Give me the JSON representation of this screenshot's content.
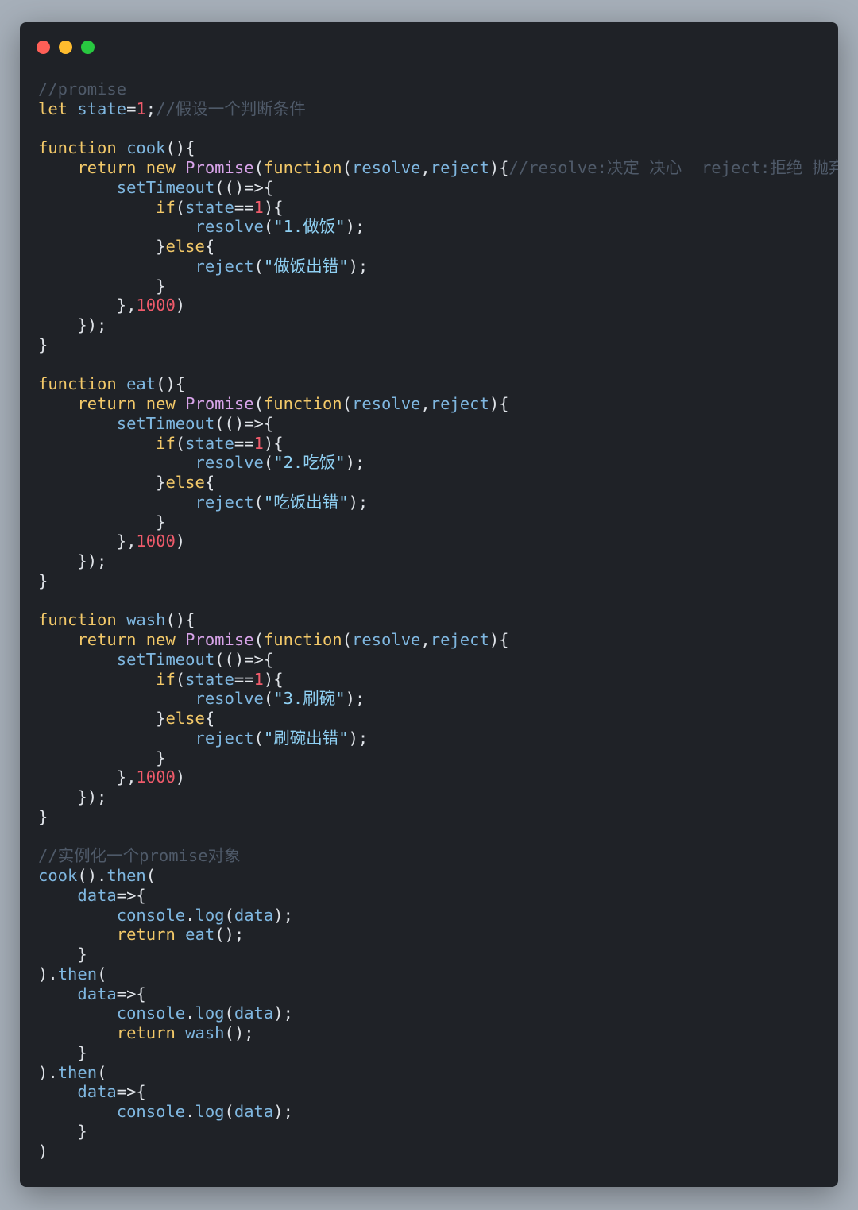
{
  "window": {
    "traffic_lights": [
      {
        "name": "close",
        "color": "#fe5f57"
      },
      {
        "name": "minimize",
        "color": "#febc2e"
      },
      {
        "name": "maximize",
        "color": "#28c840"
      }
    ]
  },
  "code_lines": [
    [
      [
        "cm",
        "//promise"
      ]
    ],
    [
      [
        "kw",
        "let"
      ],
      [
        "pl",
        " "
      ],
      [
        "vr",
        "state"
      ],
      [
        "pl",
        "="
      ],
      [
        "num",
        "1"
      ],
      [
        "pl",
        ";"
      ],
      [
        "cm",
        "//假设一个判断条件"
      ]
    ],
    [],
    [
      [
        "kw",
        "function"
      ],
      [
        "pl",
        " "
      ],
      [
        "fn",
        "cook"
      ],
      [
        "pl",
        "(){"
      ]
    ],
    [
      [
        "pl",
        "    "
      ],
      [
        "kw",
        "return"
      ],
      [
        "pl",
        " "
      ],
      [
        "kw",
        "new"
      ],
      [
        "pl",
        " "
      ],
      [
        "cls",
        "Promise"
      ],
      [
        "pl",
        "("
      ],
      [
        "kw",
        "function"
      ],
      [
        "pl",
        "("
      ],
      [
        "vr",
        "resolve"
      ],
      [
        "pl",
        ","
      ],
      [
        "vr",
        "reject"
      ],
      [
        "pl",
        "){"
      ],
      [
        "cm",
        "//resolve:决定 决心  reject:拒绝 抛弃"
      ]
    ],
    [
      [
        "pl",
        "        "
      ],
      [
        "fn",
        "setTimeout"
      ],
      [
        "pl",
        "(()=>{"
      ]
    ],
    [
      [
        "pl",
        "            "
      ],
      [
        "kw",
        "if"
      ],
      [
        "pl",
        "("
      ],
      [
        "vr",
        "state"
      ],
      [
        "pl",
        "=="
      ],
      [
        "num",
        "1"
      ],
      [
        "pl",
        "){"
      ]
    ],
    [
      [
        "pl",
        "                "
      ],
      [
        "fn",
        "resolve"
      ],
      [
        "pl",
        "("
      ],
      [
        "str",
        "\"1.做饭\""
      ],
      [
        "pl",
        ");"
      ]
    ],
    [
      [
        "pl",
        "            "
      ],
      [
        "pl",
        "}"
      ],
      [
        "kw",
        "else"
      ],
      [
        "pl",
        "{"
      ]
    ],
    [
      [
        "pl",
        "                "
      ],
      [
        "fn",
        "reject"
      ],
      [
        "pl",
        "("
      ],
      [
        "str",
        "\"做饭出错\""
      ],
      [
        "pl",
        ");"
      ]
    ],
    [
      [
        "pl",
        "            }"
      ]
    ],
    [
      [
        "pl",
        "        },"
      ],
      [
        "num",
        "1000"
      ],
      [
        "pl",
        ")"
      ]
    ],
    [
      [
        "pl",
        "    });"
      ]
    ],
    [
      [
        "pl",
        "}"
      ]
    ],
    [],
    [
      [
        "kw",
        "function"
      ],
      [
        "pl",
        " "
      ],
      [
        "fn",
        "eat"
      ],
      [
        "pl",
        "(){"
      ]
    ],
    [
      [
        "pl",
        "    "
      ],
      [
        "kw",
        "return"
      ],
      [
        "pl",
        " "
      ],
      [
        "kw",
        "new"
      ],
      [
        "pl",
        " "
      ],
      [
        "cls",
        "Promise"
      ],
      [
        "pl",
        "("
      ],
      [
        "kw",
        "function"
      ],
      [
        "pl",
        "("
      ],
      [
        "vr",
        "resolve"
      ],
      [
        "pl",
        ","
      ],
      [
        "vr",
        "reject"
      ],
      [
        "pl",
        "){"
      ]
    ],
    [
      [
        "pl",
        "        "
      ],
      [
        "fn",
        "setTimeout"
      ],
      [
        "pl",
        "(()=>{"
      ]
    ],
    [
      [
        "pl",
        "            "
      ],
      [
        "kw",
        "if"
      ],
      [
        "pl",
        "("
      ],
      [
        "vr",
        "state"
      ],
      [
        "pl",
        "=="
      ],
      [
        "num",
        "1"
      ],
      [
        "pl",
        "){"
      ]
    ],
    [
      [
        "pl",
        "                "
      ],
      [
        "fn",
        "resolve"
      ],
      [
        "pl",
        "("
      ],
      [
        "str",
        "\"2.吃饭\""
      ],
      [
        "pl",
        ");"
      ]
    ],
    [
      [
        "pl",
        "            "
      ],
      [
        "pl",
        "}"
      ],
      [
        "kw",
        "else"
      ],
      [
        "pl",
        "{"
      ]
    ],
    [
      [
        "pl",
        "                "
      ],
      [
        "fn",
        "reject"
      ],
      [
        "pl",
        "("
      ],
      [
        "str",
        "\"吃饭出错\""
      ],
      [
        "pl",
        ");"
      ]
    ],
    [
      [
        "pl",
        "            }"
      ]
    ],
    [
      [
        "pl",
        "        },"
      ],
      [
        "num",
        "1000"
      ],
      [
        "pl",
        ")"
      ]
    ],
    [
      [
        "pl",
        "    });"
      ]
    ],
    [
      [
        "pl",
        "}"
      ]
    ],
    [],
    [
      [
        "kw",
        "function"
      ],
      [
        "pl",
        " "
      ],
      [
        "fn",
        "wash"
      ],
      [
        "pl",
        "(){"
      ]
    ],
    [
      [
        "pl",
        "    "
      ],
      [
        "kw",
        "return"
      ],
      [
        "pl",
        " "
      ],
      [
        "kw",
        "new"
      ],
      [
        "pl",
        " "
      ],
      [
        "cls",
        "Promise"
      ],
      [
        "pl",
        "("
      ],
      [
        "kw",
        "function"
      ],
      [
        "pl",
        "("
      ],
      [
        "vr",
        "resolve"
      ],
      [
        "pl",
        ","
      ],
      [
        "vr",
        "reject"
      ],
      [
        "pl",
        "){"
      ]
    ],
    [
      [
        "pl",
        "        "
      ],
      [
        "fn",
        "setTimeout"
      ],
      [
        "pl",
        "(()=>{"
      ]
    ],
    [
      [
        "pl",
        "            "
      ],
      [
        "kw",
        "if"
      ],
      [
        "pl",
        "("
      ],
      [
        "vr",
        "state"
      ],
      [
        "pl",
        "=="
      ],
      [
        "num",
        "1"
      ],
      [
        "pl",
        "){"
      ]
    ],
    [
      [
        "pl",
        "                "
      ],
      [
        "fn",
        "resolve"
      ],
      [
        "pl",
        "("
      ],
      [
        "str",
        "\"3.刷碗\""
      ],
      [
        "pl",
        ");"
      ]
    ],
    [
      [
        "pl",
        "            "
      ],
      [
        "pl",
        "}"
      ],
      [
        "kw",
        "else"
      ],
      [
        "pl",
        "{"
      ]
    ],
    [
      [
        "pl",
        "                "
      ],
      [
        "fn",
        "reject"
      ],
      [
        "pl",
        "("
      ],
      [
        "str",
        "\"刷碗出错\""
      ],
      [
        "pl",
        ");"
      ]
    ],
    [
      [
        "pl",
        "            }"
      ]
    ],
    [
      [
        "pl",
        "        },"
      ],
      [
        "num",
        "1000"
      ],
      [
        "pl",
        ")"
      ]
    ],
    [
      [
        "pl",
        "    });"
      ]
    ],
    [
      [
        "pl",
        "}"
      ]
    ],
    [],
    [
      [
        "cm",
        "//实例化一个promise对象"
      ]
    ],
    [
      [
        "fn",
        "cook"
      ],
      [
        "pl",
        "()."
      ],
      [
        "fn",
        "then"
      ],
      [
        "pl",
        "("
      ]
    ],
    [
      [
        "pl",
        "    "
      ],
      [
        "vr",
        "data"
      ],
      [
        "pl",
        "=>{"
      ]
    ],
    [
      [
        "pl",
        "        "
      ],
      [
        "fn",
        "console"
      ],
      [
        "pl",
        "."
      ],
      [
        "fn",
        "log"
      ],
      [
        "pl",
        "("
      ],
      [
        "vr",
        "data"
      ],
      [
        "pl",
        ");"
      ]
    ],
    [
      [
        "pl",
        "        "
      ],
      [
        "kw",
        "return"
      ],
      [
        "pl",
        " "
      ],
      [
        "fn",
        "eat"
      ],
      [
        "pl",
        "();"
      ]
    ],
    [
      [
        "pl",
        "    }"
      ]
    ],
    [
      [
        "pl",
        ")."
      ],
      [
        "fn",
        "then"
      ],
      [
        "pl",
        "("
      ]
    ],
    [
      [
        "pl",
        "    "
      ],
      [
        "vr",
        "data"
      ],
      [
        "pl",
        "=>{"
      ]
    ],
    [
      [
        "pl",
        "        "
      ],
      [
        "fn",
        "console"
      ],
      [
        "pl",
        "."
      ],
      [
        "fn",
        "log"
      ],
      [
        "pl",
        "("
      ],
      [
        "vr",
        "data"
      ],
      [
        "pl",
        ");"
      ]
    ],
    [
      [
        "pl",
        "        "
      ],
      [
        "kw",
        "return"
      ],
      [
        "pl",
        " "
      ],
      [
        "fn",
        "wash"
      ],
      [
        "pl",
        "();"
      ]
    ],
    [
      [
        "pl",
        "    }"
      ]
    ],
    [
      [
        "pl",
        ")."
      ],
      [
        "fn",
        "then"
      ],
      [
        "pl",
        "("
      ]
    ],
    [
      [
        "pl",
        "    "
      ],
      [
        "vr",
        "data"
      ],
      [
        "pl",
        "=>{"
      ]
    ],
    [
      [
        "pl",
        "        "
      ],
      [
        "fn",
        "console"
      ],
      [
        "pl",
        "."
      ],
      [
        "fn",
        "log"
      ],
      [
        "pl",
        "("
      ],
      [
        "vr",
        "data"
      ],
      [
        "pl",
        ");"
      ]
    ],
    [
      [
        "pl",
        "    }"
      ]
    ],
    [
      [
        "pl",
        ")"
      ]
    ]
  ]
}
